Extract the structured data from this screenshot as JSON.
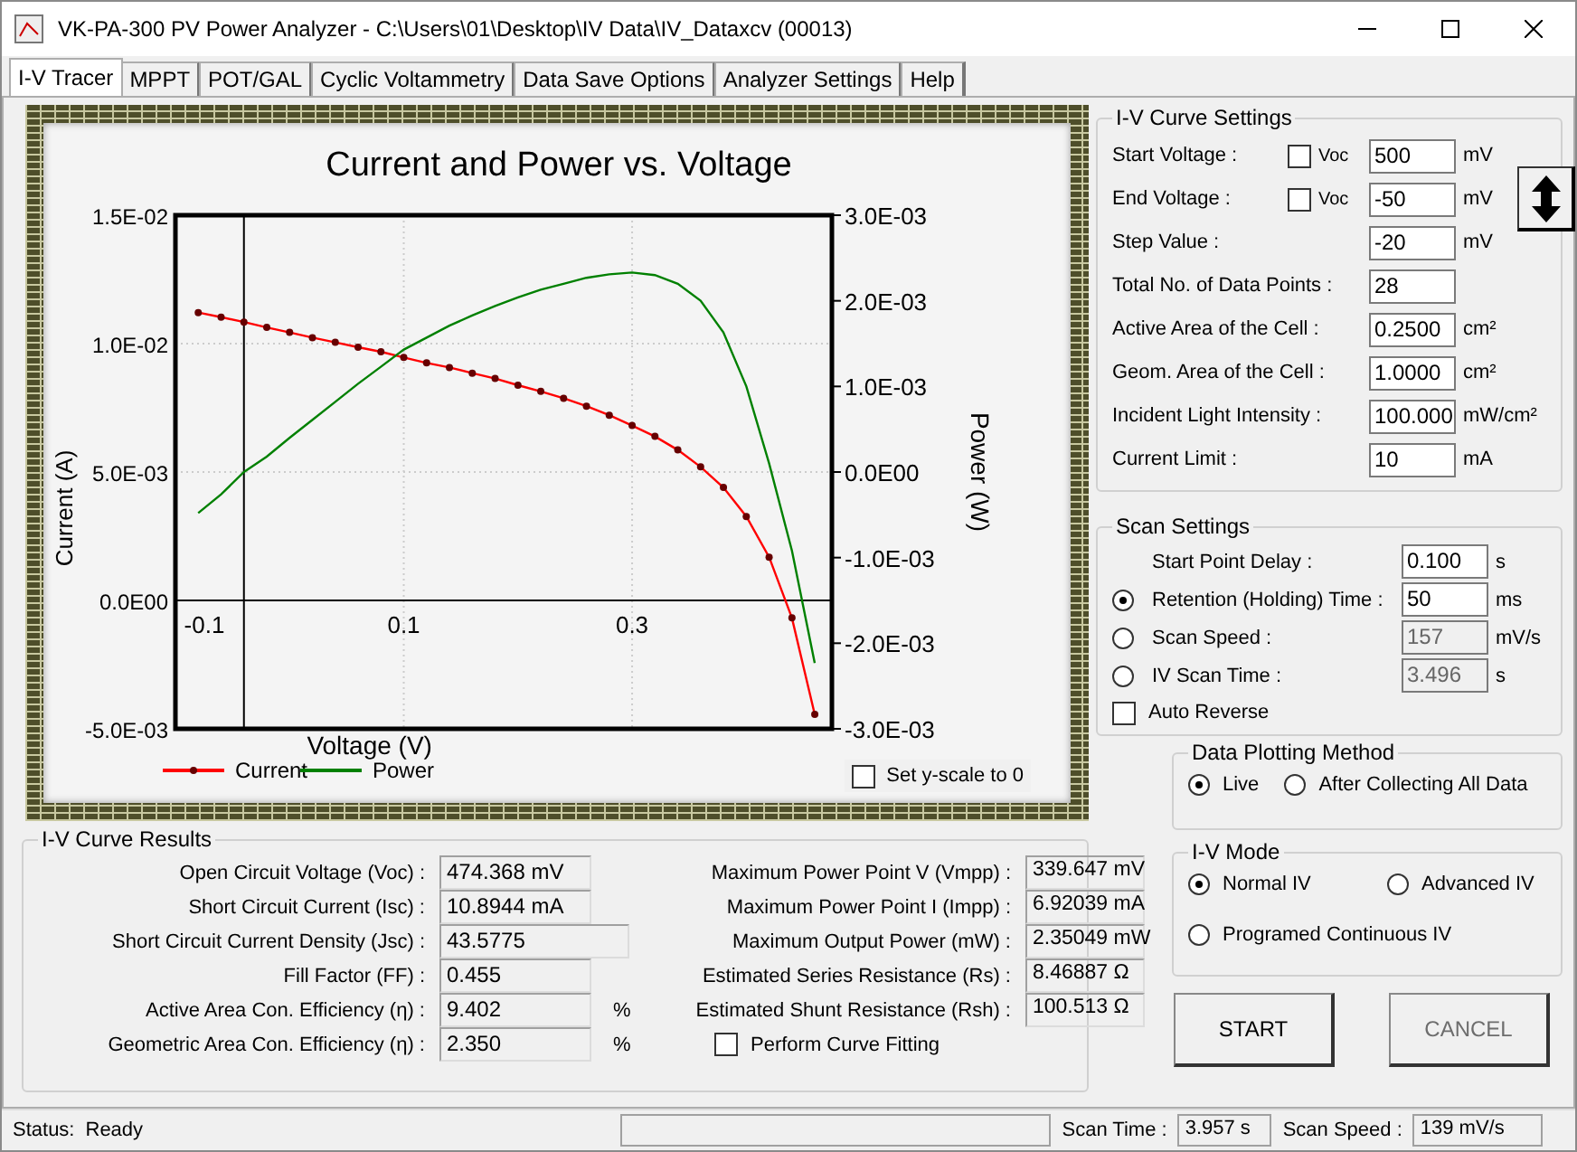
{
  "window": {
    "title": "VK-PA-300 PV Power Analyzer - C:\\Users\\01\\Desktop\\IV Data\\IV_Dataxcv (00013)"
  },
  "tabs": [
    {
      "label": "I-V Tracer",
      "selected": true
    },
    {
      "label": "MPPT",
      "selected": false
    },
    {
      "label": "POT/GAL",
      "selected": false
    },
    {
      "label": "Cyclic Voltammetry",
      "selected": false
    },
    {
      "label": "Data Save Options",
      "selected": false
    },
    {
      "label": "Analyzer Settings",
      "selected": false
    },
    {
      "label": "Help",
      "selected": false
    }
  ],
  "chart": {
    "chart_data": {
      "type": "line",
      "title": "Current and Power vs. Voltage",
      "xlabel": "Voltage (V)",
      "ylabel": "Current (A)",
      "y2label": "Power (W)",
      "x": [
        -0.08,
        -0.06,
        -0.04,
        -0.02,
        0,
        0.02,
        0.04,
        0.06,
        0.08,
        0.1,
        0.12,
        0.14,
        0.16,
        0.18,
        0.2,
        0.22,
        0.24,
        0.26,
        0.28,
        0.3,
        0.32,
        0.34,
        0.36,
        0.38,
        0.4,
        0.42,
        0.44,
        0.46
      ],
      "grid": true,
      "legend": "bottom",
      "ref_lines": [
        {
          "axis": "x",
          "value": -0.04
        }
      ],
      "series": [
        {
          "name": "Current",
          "color": "#ff0000",
          "marker": "o",
          "values": [
            0.01121,
            0.01103,
            0.01084,
            0.01063,
            0.01044,
            0.01023,
            0.01005,
            0.00986,
            0.00968,
            0.00946,
            0.00925,
            0.00907,
            0.00885,
            0.00864,
            0.00838,
            0.00814,
            0.00787,
            0.00756,
            0.00721,
            0.00681,
            0.00639,
            0.00586,
            0.0052,
            0.0044,
            0.00327,
            0.00168,
            -0.00068,
            -0.00444
          ]
        },
        {
          "name": "Power",
          "color": "#008000",
          "axis": "y2",
          "values": [
            -0.00048,
            -0.00026,
            0,
            0.00018,
            0.0004,
            0.00061,
            0.00082,
            0.00103,
            0.00123,
            0.00143,
            0.00157,
            0.00171,
            0.00183,
            0.00194,
            0.00204,
            0.00213,
            0.0022,
            0.00227,
            0.00231,
            0.00233,
            0.0023,
            0.0022,
            0.002,
            0.00163,
            0.001,
            0.0001,
            -0.00092,
            -0.00223
          ]
        }
      ],
      "xlim": [
        -0.1,
        0.475
      ],
      "ylim": [
        -0.005,
        0.015
      ],
      "y2lim": [
        -0.003,
        0.003
      ],
      "xticks": [
        -0.1,
        0.1,
        0.3
      ],
      "yticks": [
        {
          "value": 0.015,
          "label": "1.5E-02"
        },
        {
          "value": 0.01,
          "label": "1.0E-02"
        },
        {
          "value": 0.005,
          "label": "5.0E-03"
        },
        {
          "value": 0,
          "label": "0.0E00"
        },
        {
          "value": -0.005,
          "label": "-5.0E-03"
        }
      ],
      "y2ticks": [
        {
          "value": 0.003,
          "label": "3.0E-03"
        },
        {
          "value": 0.002,
          "label": "2.0E-03"
        },
        {
          "value": 0.001,
          "label": "1.0E-03"
        },
        {
          "value": 0,
          "label": "0.0E00"
        },
        {
          "value": -0.001,
          "label": "-1.0E-03"
        },
        {
          "value": -0.002,
          "label": "-2.0E-03"
        },
        {
          "value": -0.003,
          "label": "-3.0E-03"
        }
      ]
    },
    "y_scale_zero": {
      "label": "Set y-scale to 0",
      "checked": false
    }
  },
  "iv_curve_settings": {
    "title": "I-V Curve Settings",
    "rows": [
      {
        "label": "Start Voltage :",
        "voc": {
          "label": "Voc",
          "checked": false
        },
        "value": "500",
        "unit": "mV"
      },
      {
        "label": "End Voltage :",
        "voc": {
          "label": "Voc",
          "checked": false
        },
        "value": "-50",
        "unit": "mV"
      },
      {
        "label": "Step Value :",
        "value": "-20",
        "unit": "mV"
      },
      {
        "label": "Total No. of Data Points :",
        "value": "28"
      },
      {
        "label": "Active Area of the Cell :",
        "value": "0.2500",
        "unit": "cm²"
      },
      {
        "label": "Geom. Area of the Cell :",
        "value": "1.0000",
        "unit": "cm²"
      },
      {
        "label": "Incident Light Intensity :",
        "value": "100.000",
        "unit": "mW/cm²"
      },
      {
        "label": "Current Limit :",
        "value": "10",
        "unit": "mA"
      }
    ]
  },
  "scan_settings": {
    "title": "Scan Settings",
    "rows": [
      {
        "kind": "plain",
        "label": "Start Point Delay :",
        "value": "0.100",
        "unit": "s",
        "disabled": false
      },
      {
        "kind": "radio",
        "label": "Retention (Holding) Time :",
        "value": "50",
        "unit": "ms",
        "selected": true,
        "disabled": false
      },
      {
        "kind": "radio",
        "label": "Scan Speed :",
        "value": "157",
        "unit": "mV/s",
        "selected": false,
        "disabled": true
      },
      {
        "kind": "radio",
        "label": "IV Scan Time :",
        "value": "3.496",
        "unit": "s",
        "selected": false,
        "disabled": true
      }
    ],
    "auto_reverse": {
      "label": "Auto Reverse",
      "checked": false
    }
  },
  "data_plotting_method": {
    "title": "Data Plotting Method",
    "options": [
      {
        "label": "Live",
        "selected": true
      },
      {
        "label": "After Collecting All Data",
        "selected": false
      }
    ]
  },
  "iv_mode": {
    "title": "I-V Mode",
    "options": [
      {
        "label": "Normal IV",
        "selected": true
      },
      {
        "label": "Advanced IV",
        "selected": false
      },
      {
        "label": "Programed Continuous IV",
        "selected": false
      }
    ]
  },
  "buttons": [
    {
      "label": "START",
      "disabled": false
    },
    {
      "label": "CANCEL",
      "disabled": true
    }
  ],
  "results": {
    "title": "I-V Curve Results",
    "left": [
      {
        "label": "Open Circuit Voltage (Voc) :",
        "value": "474.368 mV"
      },
      {
        "label": "Short Circuit Current (Isc) :",
        "value": "10.8944 mA"
      },
      {
        "label": "Short Circuit Current Density (Jsc) :",
        "value": "43.5775"
      },
      {
        "label": "Fill Factor (FF) :",
        "value": "0.455"
      },
      {
        "label": "Active Area Con. Efficiency (η) :",
        "value": "9.402",
        "unit": "%"
      },
      {
        "label": "Geometric Area Con. Efficiency (η) :",
        "value": "2.350",
        "unit": "%"
      }
    ],
    "right": [
      {
        "label": "Maximum Power Point V (Vmpp) :",
        "value": "339.647 mV"
      },
      {
        "label": "Maximum Power Point I (Impp) :",
        "value": "6.92039 mA"
      },
      {
        "label": "Maximum Output Power (mW) :",
        "value": "2.35049 mW"
      },
      {
        "label": "Estimated Series Resistance (Rs) :",
        "value": "8.46887 Ω"
      },
      {
        "label": "Estimated Shunt Resistance (Rsh) :",
        "value": "100.513 Ω"
      }
    ],
    "curve_fitting": {
      "label": "Perform Curve Fitting",
      "checked": false
    }
  },
  "status_bar": {
    "label": "Status:",
    "status": "Ready",
    "scan_time_label": "Scan Time :",
    "scan_time": "3.957 s",
    "scan_speed_label": "Scan Speed :",
    "scan_speed": "139 mV/s"
  }
}
